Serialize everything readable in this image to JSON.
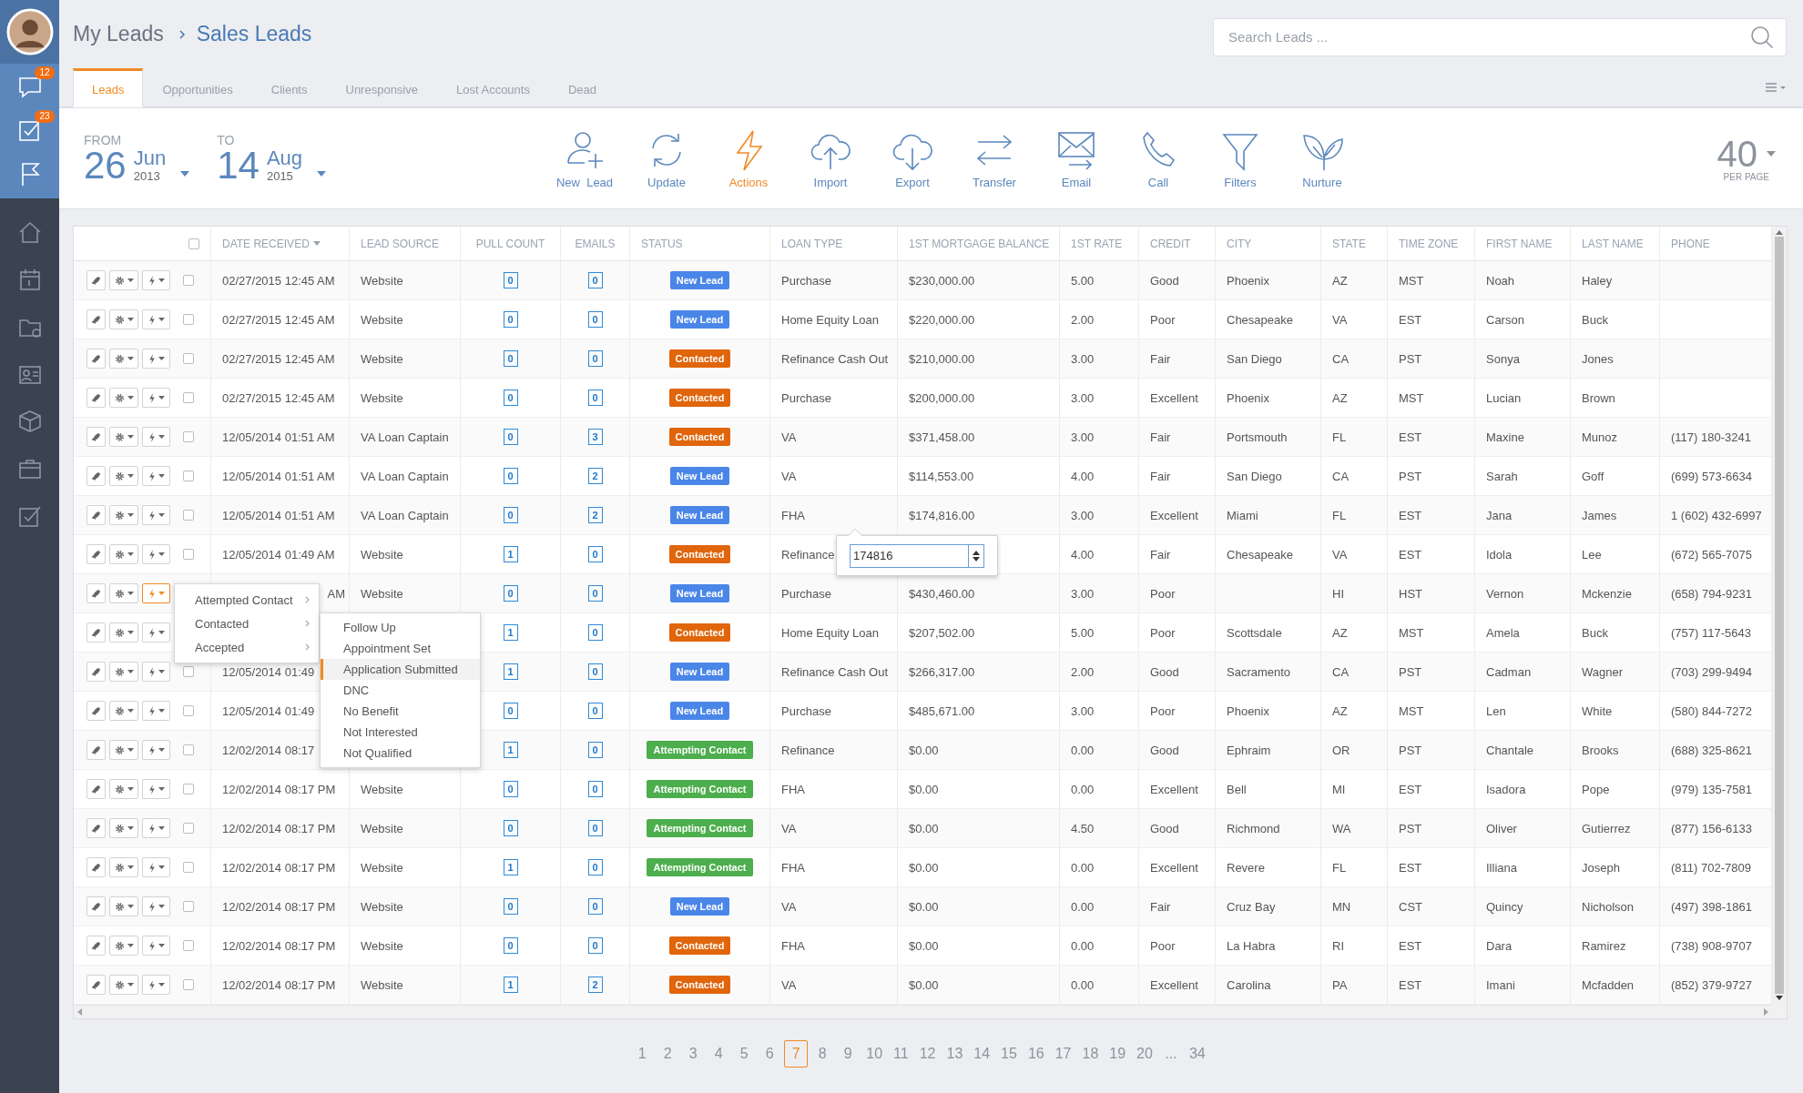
{
  "sidebar": {
    "top": [
      {
        "kind": "chat",
        "badge": "12"
      },
      {
        "kind": "tasks",
        "badge": "23"
      },
      {
        "kind": "flag"
      }
    ],
    "bottom": [
      {
        "kind": "home"
      },
      {
        "kind": "calendar"
      },
      {
        "kind": "folder"
      },
      {
        "kind": "contact"
      },
      {
        "kind": "box"
      },
      {
        "kind": "briefcase"
      },
      {
        "kind": "checklist"
      }
    ]
  },
  "breadcrumb": [
    "My Leads",
    "Sales Leads"
  ],
  "search": {
    "placeholder": "Search Leads ..."
  },
  "tabs": [
    {
      "label": "Leads",
      "selected": true
    },
    {
      "label": "Opportunities",
      "selected": false
    },
    {
      "label": "Clients",
      "selected": false
    },
    {
      "label": "Unresponsive",
      "selected": false
    },
    {
      "label": "Lost Accounts",
      "selected": false
    },
    {
      "label": "Dead",
      "selected": false
    }
  ],
  "date_range": {
    "from": {
      "label": "FROM",
      "day": "26",
      "month": "Jun",
      "year": "2013"
    },
    "to": {
      "label": "TO",
      "day": "14",
      "month": "Aug",
      "year": "2015"
    }
  },
  "toolbar": {
    "tools": [
      {
        "kind": "new_lead",
        "label": "New  Lead",
        "active": false
      },
      {
        "kind": "update",
        "label": "Update",
        "active": false
      },
      {
        "kind": "actions",
        "label": "Actions",
        "active": true
      },
      {
        "kind": "import",
        "label": "Import",
        "active": false
      },
      {
        "kind": "export",
        "label": "Export",
        "active": false
      },
      {
        "kind": "transfer",
        "label": "Transfer",
        "active": false
      },
      {
        "kind": "email",
        "label": "Email",
        "active": false
      },
      {
        "kind": "call",
        "label": "Call",
        "active": false
      },
      {
        "kind": "filters",
        "label": "Filters",
        "active": false
      },
      {
        "kind": "nurture",
        "label": "Nurture",
        "active": false
      }
    ]
  },
  "per_page": {
    "value": "40",
    "label": "PER PAGE"
  },
  "table": {
    "select_all": {
      "checked": false
    },
    "columns": [
      {
        "label": "DATE RECEIVED",
        "sorted": true
      },
      {
        "label": "LEAD SOURCE",
        "sorted": false
      },
      {
        "label": "PULL COUNT",
        "sorted": false
      },
      {
        "label": "EMAILS",
        "sorted": false
      },
      {
        "label": "STATUS",
        "sorted": false
      },
      {
        "label": "LOAN TYPE",
        "sorted": false
      },
      {
        "label": "1ST MORTGAGE BALANCE",
        "sorted": false
      },
      {
        "label": "1ST RATE",
        "sorted": false
      },
      {
        "label": "CREDIT",
        "sorted": false
      },
      {
        "label": "CITY",
        "sorted": false
      },
      {
        "label": "STATE",
        "sorted": false
      },
      {
        "label": "TIME ZONE",
        "sorted": false
      },
      {
        "label": "FIRST NAME",
        "sorted": false
      },
      {
        "label": "LAST NAME",
        "sorted": false
      },
      {
        "label": "PHONE",
        "sorted": false
      }
    ],
    "rows": [
      {
        "actions_open": false,
        "checked": false,
        "date": "02/27/2015 12:45 AM",
        "source": "Website",
        "pull_count": "0",
        "emails": "0",
        "status": {
          "label": "New Lead",
          "color": "#4a86e8"
        },
        "loan_type": "Purchase",
        "balance": "$230,000.00",
        "rate": "5.00",
        "credit": "Good",
        "city": "Phoenix",
        "state": "AZ",
        "time_zone": "MST",
        "first_name": "Noah",
        "last_name": "Haley"
      },
      {
        "actions_open": false,
        "checked": false,
        "date": "02/27/2015 12:45 AM",
        "source": "Website",
        "pull_count": "0",
        "emails": "0",
        "status": {
          "label": "New Lead",
          "color": "#4a86e8"
        },
        "loan_type": "Home Equity Loan",
        "balance": "$220,000.00",
        "rate": "2.00",
        "credit": "Poor",
        "city": "Chesapeake",
        "state": "VA",
        "time_zone": "EST",
        "first_name": "Carson",
        "last_name": "Buck"
      },
      {
        "actions_open": false,
        "checked": false,
        "date": "02/27/2015 12:45 AM",
        "source": "Website",
        "pull_count": "0",
        "emails": "0",
        "status": {
          "label": "Contacted",
          "color": "#e0650b"
        },
        "loan_type": "Refinance Cash Out",
        "balance": "$210,000.00",
        "rate": "3.00",
        "credit": "Fair",
        "city": "San Diego",
        "state": "CA",
        "time_zone": "PST",
        "first_name": "Sonya",
        "last_name": "Jones"
      },
      {
        "actions_open": false,
        "checked": false,
        "date": "02/27/2015 12:45 AM",
        "source": "Website",
        "pull_count": "0",
        "emails": "0",
        "status": {
          "label": "Contacted",
          "color": "#e0650b"
        },
        "loan_type": "Purchase",
        "balance": "$200,000.00",
        "rate": "3.00",
        "credit": "Excellent",
        "city": "Phoenix",
        "state": "AZ",
        "time_zone": "MST",
        "first_name": "Lucian",
        "last_name": "Brown"
      },
      {
        "actions_open": false,
        "checked": false,
        "date": "12/05/2014 01:51 AM",
        "source": "VA Loan Captain",
        "pull_count": "0",
        "emails": "3",
        "status": {
          "label": "Contacted",
          "color": "#e0650b"
        },
        "loan_type": "VA",
        "balance": "$371,458.00",
        "rate": "3.00",
        "credit": "Fair",
        "city": "Portsmouth",
        "state": "FL",
        "time_zone": "EST",
        "first_name": "Maxine",
        "last_name": "Munoz",
        "phone": "(117) 180-3241"
      },
      {
        "actions_open": false,
        "checked": false,
        "date": "12/05/2014 01:51 AM",
        "source": "VA Loan Captain",
        "pull_count": "0",
        "emails": "2",
        "status": {
          "label": "New Lead",
          "color": "#4a86e8"
        },
        "loan_type": "VA",
        "balance": "$114,553.00",
        "rate": "4.00",
        "credit": "Fair",
        "city": "San Diego",
        "state": "CA",
        "time_zone": "PST",
        "first_name": "Sarah",
        "last_name": "Goff",
        "phone": "(699) 573-6634"
      },
      {
        "actions_open": false,
        "checked": false,
        "date": "12/05/2014 01:51 AM",
        "source": "VA Loan Captain",
        "pull_count": "0",
        "emails": "2",
        "status": {
          "label": "New Lead",
          "color": "#4a86e8"
        },
        "loan_type": "FHA",
        "balance": "$174,816.00",
        "rate": "3.00",
        "credit": "Excellent",
        "city": "Miami",
        "state": "FL",
        "time_zone": "EST",
        "first_name": "Jana",
        "last_name": "James",
        "phone": "1 (602) 432-6997"
      },
      {
        "actions_open": false,
        "checked": false,
        "date": "12/05/2014 01:49 AM",
        "source": "Website",
        "pull_count": "1",
        "emails": "0",
        "status": {
          "label": "Contacted",
          "color": "#e0650b"
        },
        "loan_type": "Refinance",
        "rate": "4.00",
        "credit": "Fair",
        "city": "Chesapeake",
        "state": "VA",
        "time_zone": "EST",
        "first_name": "Idola",
        "last_name": "Lee",
        "phone": "(672) 565-7075"
      },
      {
        "actions_open": true,
        "date": "AM",
        "date_cut": true,
        "source": "Website",
        "pull_count": "0",
        "emails": "0",
        "status": {
          "label": "New Lead",
          "color": "#4a86e8"
        },
        "loan_type": "Purchase",
        "balance": "$430,460.00",
        "rate": "3.00",
        "credit": "Poor",
        "state": "HI",
        "time_zone": "HST",
        "first_name": "Vernon",
        "last_name": "Mckenzie",
        "phone": "(658) 794-9231"
      },
      {
        "actions_open": false,
        "pull_count": "1",
        "emails": "0",
        "status": {
          "label": "Contacted",
          "color": "#e0650b"
        },
        "loan_type": "Home Equity Loan",
        "balance": "$207,502.00",
        "rate": "5.00",
        "credit": "Poor",
        "city": "Scottsdale",
        "state": "AZ",
        "time_zone": "MST",
        "first_name": "Amela",
        "last_name": "Buck",
        "phone": "(757) 117-5643"
      },
      {
        "actions_open": false,
        "checked": false,
        "date": "12/05/2014 01:49",
        "pull_count": "1",
        "emails": "0",
        "status": {
          "label": "New Lead",
          "color": "#4a86e8"
        },
        "loan_type": "Refinance Cash Out",
        "balance": "$266,317.00",
        "rate": "2.00",
        "credit": "Good",
        "city": "Sacramento",
        "state": "CA",
        "time_zone": "PST",
        "first_name": "Cadman",
        "last_name": "Wagner",
        "phone": "(703) 299-9494"
      },
      {
        "actions_open": false,
        "checked": false,
        "date": "12/05/2014 01:49",
        "pull_count": "0",
        "emails": "0",
        "status": {
          "label": "New Lead",
          "color": "#4a86e8"
        },
        "loan_type": "Purchase",
        "balance": "$485,671.00",
        "rate": "3.00",
        "credit": "Poor",
        "city": "Phoenix",
        "state": "AZ",
        "time_zone": "MST",
        "first_name": "Len",
        "last_name": "White",
        "phone": "(580) 844-7272"
      },
      {
        "actions_open": false,
        "checked": false,
        "date": "12/02/2014 08:17",
        "pull_count": "1",
        "emails": "0",
        "status": {
          "label": "Attempting Contact",
          "color": "#4cae4c"
        },
        "loan_type": "Refinance",
        "balance": "$0.00",
        "rate": "0.00",
        "credit": "Good",
        "city": "Ephraim",
        "state": "OR",
        "time_zone": "PST",
        "first_name": "Chantale",
        "last_name": "Brooks",
        "phone": "(688) 325-8621"
      },
      {
        "actions_open": false,
        "checked": false,
        "date": "12/02/2014 08:17 PM",
        "source": "Website",
        "pull_count": "0",
        "emails": "0",
        "status": {
          "label": "Attempting Contact",
          "color": "#4cae4c"
        },
        "loan_type": "FHA",
        "balance": "$0.00",
        "rate": "0.00",
        "credit": "Excellent",
        "city": "Bell",
        "state": "MI",
        "time_zone": "EST",
        "first_name": "Isadora",
        "last_name": "Pope",
        "phone": "(979) 135-7581"
      },
      {
        "actions_open": false,
        "checked": false,
        "date": "12/02/2014 08:17 PM",
        "source": "Website",
        "pull_count": "0",
        "emails": "0",
        "status": {
          "label": "Attempting Contact",
          "color": "#4cae4c"
        },
        "loan_type": "VA",
        "balance": "$0.00",
        "rate": "4.50",
        "credit": "Good",
        "city": "Richmond",
        "state": "WA",
        "time_zone": "PST",
        "first_name": "Oliver",
        "last_name": "Gutierrez",
        "phone": "(877) 156-6133"
      },
      {
        "actions_open": false,
        "checked": false,
        "date": "12/02/2014 08:17 PM",
        "source": "Website",
        "pull_count": "1",
        "emails": "0",
        "status": {
          "label": "Attempting Contact",
          "color": "#4cae4c"
        },
        "loan_type": "FHA",
        "balance": "$0.00",
        "rate": "0.00",
        "credit": "Excellent",
        "city": "Revere",
        "state": "FL",
        "time_zone": "EST",
        "first_name": "Illiana",
        "last_name": "Joseph",
        "phone": "(811) 702-7809"
      },
      {
        "actions_open": false,
        "checked": false,
        "date": "12/02/2014 08:17 PM",
        "source": "Website",
        "pull_count": "0",
        "emails": "0",
        "status": {
          "label": "New Lead",
          "color": "#4a86e8"
        },
        "loan_type": "VA",
        "balance": "$0.00",
        "rate": "0.00",
        "credit": "Fair",
        "city": "Cruz Bay",
        "state": "MN",
        "time_zone": "CST",
        "first_name": "Quincy",
        "last_name": "Nicholson",
        "phone": "(497) 398-1861"
      },
      {
        "actions_open": false,
        "checked": false,
        "date": "12/02/2014 08:17 PM",
        "source": "Website",
        "pull_count": "0",
        "emails": "0",
        "status": {
          "label": "Contacted",
          "color": "#e0650b"
        },
        "loan_type": "FHA",
        "balance": "$0.00",
        "rate": "0.00",
        "credit": "Poor",
        "city": "La Habra",
        "state": "RI",
        "time_zone": "EST",
        "first_name": "Dara",
        "last_name": "Ramirez",
        "phone": "(738) 908-9707"
      },
      {
        "actions_open": false,
        "checked": false,
        "date": "12/02/2014 08:17 PM",
        "source": "Website",
        "pull_count": "1",
        "emails": "2",
        "status": {
          "label": "Contacted",
          "color": "#e0650b"
        },
        "loan_type": "VA",
        "balance": "$0.00",
        "rate": "0.00",
        "credit": "Excellent",
        "city": "Carolina",
        "state": "PA",
        "time_zone": "EST",
        "first_name": "Imani",
        "last_name": "Mcfadden",
        "phone": "(852) 379-9727"
      }
    ]
  },
  "row_menu": {
    "items": [
      {
        "label": "Attempted Contact"
      },
      {
        "label": "Contacted"
      },
      {
        "label": "Accepted"
      }
    ],
    "submenu": [
      {
        "label": "Follow Up",
        "selected": false
      },
      {
        "label": "Appointment Set",
        "selected": false
      },
      {
        "label": "Application Submitted",
        "selected": true
      },
      {
        "label": "DNC",
        "selected": false
      },
      {
        "label": "No Benefit",
        "selected": false
      },
      {
        "label": "Not Interested",
        "selected": false
      },
      {
        "label": "Not Qualified",
        "selected": false
      }
    ]
  },
  "balance_editor": {
    "value": "174816"
  },
  "pagination": {
    "pages": [
      {
        "label": "1",
        "selected": false
      },
      {
        "label": "2",
        "selected": false
      },
      {
        "label": "3",
        "selected": false
      },
      {
        "label": "4",
        "selected": false
      },
      {
        "label": "5",
        "selected": false
      },
      {
        "label": "6",
        "selected": false
      },
      {
        "label": "7",
        "selected": true
      },
      {
        "label": "8",
        "selected": false
      },
      {
        "label": "9",
        "selected": false
      },
      {
        "label": "10",
        "selected": false
      },
      {
        "label": "11",
        "selected": false
      },
      {
        "label": "12",
        "selected": false
      },
      {
        "label": "13",
        "selected": false
      },
      {
        "label": "14",
        "selected": false
      },
      {
        "label": "15",
        "selected": false
      },
      {
        "label": "16",
        "selected": false
      },
      {
        "label": "17",
        "selected": false
      },
      {
        "label": "18",
        "selected": false
      },
      {
        "label": "19",
        "selected": false
      },
      {
        "label": "20",
        "selected": false
      },
      {
        "label": "...",
        "selected": false
      },
      {
        "label": "34",
        "selected": false
      }
    ]
  }
}
